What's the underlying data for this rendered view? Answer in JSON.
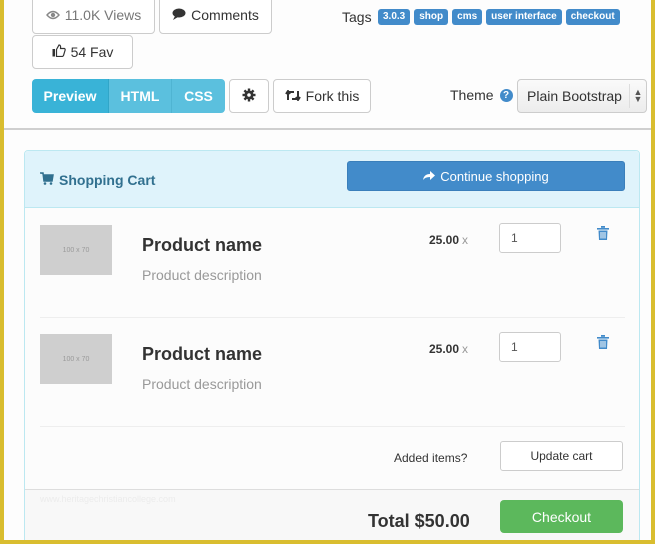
{
  "toolbar": {
    "views_label": "11.0K Views",
    "comments_label": "Comments",
    "fav_label": "54 Fav",
    "tags_label": "Tags",
    "tags": [
      "3.0.3",
      "shop",
      "cms",
      "user interface",
      "checkout"
    ],
    "view_tabs": [
      "Preview",
      "HTML",
      "CSS"
    ],
    "active_tab": "Preview",
    "fork_label": "Fork this",
    "theme_label": "Theme",
    "theme_help": "?",
    "theme_value": "Plain Bootstrap"
  },
  "cart": {
    "title": "Shopping Cart",
    "continue_label": "Continue shopping",
    "items": [
      {
        "thumb": "100 x 70",
        "name": "Product name",
        "description": "Product description",
        "price": "25.00",
        "times": "x",
        "quantity": "1"
      },
      {
        "thumb": "100 x 70",
        "name": "Product name",
        "description": "Product description",
        "price": "25.00",
        "times": "x",
        "quantity": "1"
      }
    ],
    "added_items_label": "Added items?",
    "update_label": "Update cart",
    "watermark": "www.heritagechristiancollege.com",
    "total_label": "Total $50.00",
    "checkout_label": "Checkout"
  },
  "colors": {
    "primary": "#428bca",
    "info": "#5bc0de",
    "success": "#5cb85c",
    "panel_head": "#dff3fb",
    "frame": "#d9bd2f"
  }
}
